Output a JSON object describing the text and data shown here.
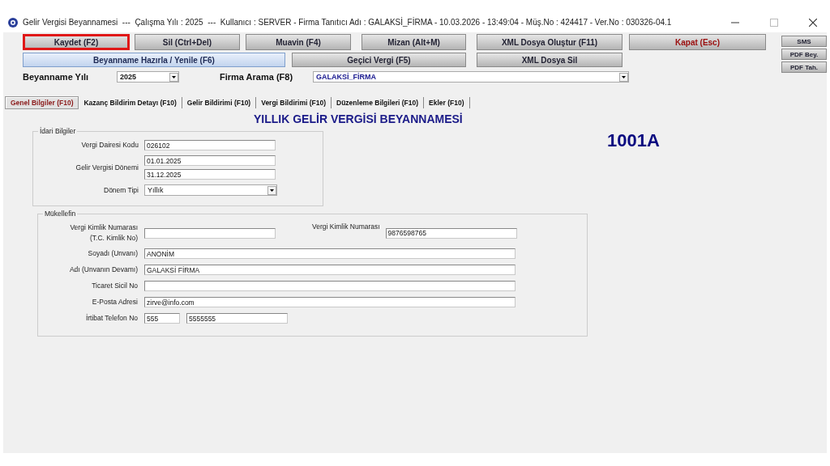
{
  "window": {
    "title": "Gelir Vergisi Beyannamesi  ---  Çalışma Yılı : 2025  ---  Kullanıcı : SERVER - Firma Tanıtıcı Adı : GALAKSİ_FİRMA - 10.03.2026 - 13:49:04 - Müş.No : 424417 - Ver.No : 030326-04.1"
  },
  "toolbar_rows": [
    [
      {
        "label": "Kaydet (F2)",
        "kind": "normal",
        "focused": true
      },
      {
        "label": "Sil (Ctrl+Del)",
        "kind": "normal",
        "focused": false
      },
      {
        "label": "Muavin (F4)",
        "kind": "normal",
        "focused": false
      },
      {
        "label": "Mizan (Alt+M)",
        "kind": "normal",
        "focused": false
      },
      {
        "label": "XML Dosya Oluştur (F11)",
        "kind": "normal",
        "focused": false
      },
      {
        "label": "Kapat (Esc)",
        "kind": "danger",
        "focused": false
      }
    ],
    [
      {
        "label": "Beyanname Hazırla / Yenile (F6)",
        "kind": "primary",
        "focused": false
      },
      {
        "label": "Geçici Vergi (F5)",
        "kind": "normal",
        "focused": false
      },
      {
        "label": "XML Dosya Sil",
        "kind": "normal",
        "focused": false
      }
    ]
  ],
  "side_buttons": [
    "SMS",
    "PDF Bey.",
    "PDF Tah."
  ],
  "filters": {
    "year_label": "Beyanname Yılı",
    "year": "2025",
    "firm_label": "Firma Arama (F8)",
    "firm": "GALAKSİ_FİRMA"
  },
  "tabs": [
    {
      "label": "Genel Bilgiler (F10)",
      "selected": true
    },
    {
      "label": "Kazanç Bildirim Detayı (F10)",
      "selected": false
    },
    {
      "label": "Gelir Bildirimi (F10)",
      "selected": false
    },
    {
      "label": "Vergi Bildirimi (F10)",
      "selected": false
    },
    {
      "label": "Düzenleme Bilgileri (F10)",
      "selected": false
    },
    {
      "label": "Ekler (F10)",
      "selected": false
    }
  ],
  "form_title": "YILLIK GELİR VERGİSİ BEYANNAMESİ",
  "form_code": "1001A",
  "idari": {
    "legend": "İdari Bilgiler",
    "rows": [
      {
        "label": "Vergi Dairesi Kodu",
        "fields": [
          {
            "kind": "short",
            "value": "026102"
          }
        ]
      },
      {
        "label": "Gelir Vergisi Dönemi",
        "fields": [
          {
            "kind": "short",
            "value": "01.01.2025"
          },
          {
            "kind": "short",
            "value": "31.12.2025"
          }
        ]
      },
      {
        "label": "Dönem Tipi",
        "fields": [
          {
            "kind": "select",
            "value": "Yıllık"
          }
        ]
      }
    ]
  },
  "mukellef": {
    "legend": "Mükellefin",
    "rows": [
      {
        "label": "Vergi Kimlik Numarası\n(T.C. Kimlik No)",
        "fields": [
          {
            "kind": "short"
          }
        ],
        "extra": {
          "label": "Vergi Kimlik Numarası",
          "value": "9876598765"
        }
      },
      {
        "label": "Soyadı (Unvanı)",
        "fields": [
          {
            "kind": "long",
            "value": "ANONİM"
          }
        ]
      },
      {
        "label": "Adı (Unvanın Devamı)",
        "fields": [
          {
            "kind": "long",
            "value": "GALAKSİ FİRMA"
          }
        ]
      },
      {
        "label": "Ticaret Sicil No",
        "fields": [
          {
            "kind": "long"
          }
        ]
      },
      {
        "label": "E-Posta Adresi",
        "fields": [
          {
            "kind": "long",
            "value": "zirve@info.com"
          }
        ]
      },
      {
        "label": "İrtibat Telefon No",
        "fields": [
          {
            "kind": "tiny",
            "value": "555"
          },
          {
            "kind": "medium",
            "value": "5555555"
          }
        ]
      }
    ]
  }
}
